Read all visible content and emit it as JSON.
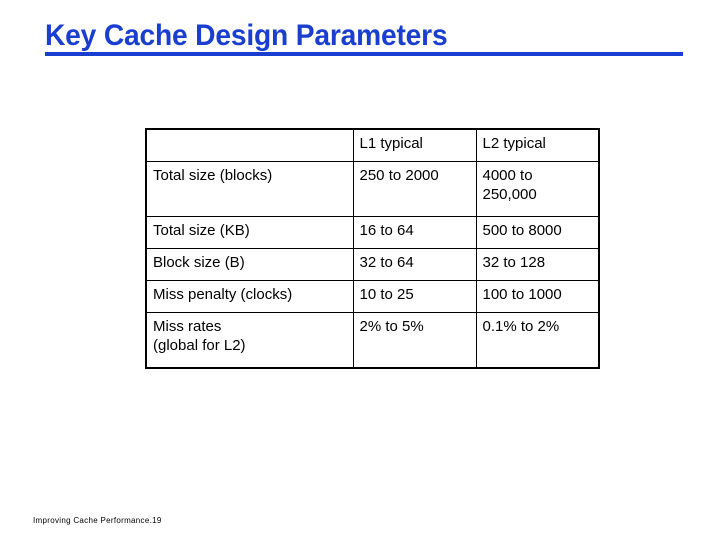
{
  "slide": {
    "title": "Key Cache Design Parameters",
    "title_color": "#1a3fd0",
    "background_color": "#ffffff",
    "footer": "Improving Cache Performance.19"
  },
  "table": {
    "headers": {
      "parameter": "",
      "l1": "L1 typical",
      "l2": "L2 typical"
    },
    "rows": [
      {
        "parameter": "Total size (blocks)",
        "l1": "250 to 2000",
        "l2_line1": "4000 to",
        "l2_line2": "250,000"
      },
      {
        "parameter": "Total size (KB)",
        "l1": "16 to 64",
        "l2": "500 to 8000"
      },
      {
        "parameter": "Block size (B)",
        "l1": "32 to 64",
        "l2": "32 to 128"
      },
      {
        "parameter": "Miss penalty (clocks)",
        "l1": "10 to 25",
        "l2": "100 to 1000"
      },
      {
        "parameter_line1": "Miss rates",
        "parameter_line2": "(global for L2)",
        "l1": "2% to 5%",
        "l2": "0.1% to 2%"
      }
    ]
  }
}
